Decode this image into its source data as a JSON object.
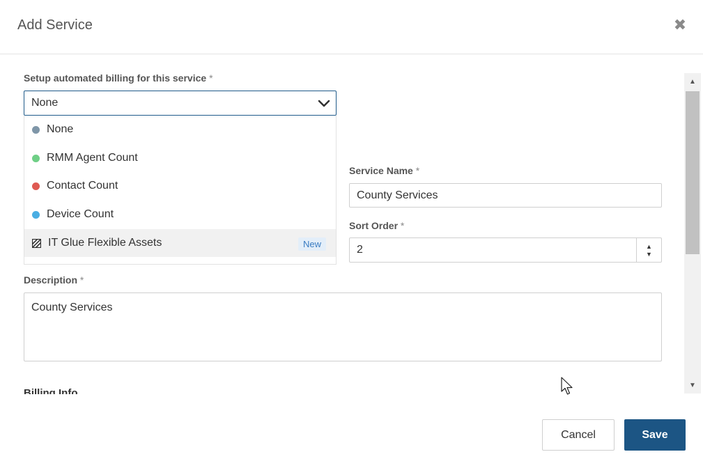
{
  "modal": {
    "title": "Add Service",
    "close_icon": "close-icon"
  },
  "billing": {
    "label": "Setup automated billing for this service",
    "required_mark": "*",
    "selected": "None",
    "options": [
      {
        "label": "None",
        "dot_color": "#7f96a8"
      },
      {
        "label": "RMM Agent Count",
        "dot_color": "#6fcf86"
      },
      {
        "label": "Contact Count",
        "dot_color": "#df5a52"
      },
      {
        "label": "Device Count",
        "dot_color": "#4aaee3"
      },
      {
        "label": "IT Glue Flexible Assets",
        "icon": "it-glue-icon",
        "badge": "New"
      }
    ]
  },
  "service_name": {
    "label": "Service Name",
    "required_mark": "*",
    "value": "County Services"
  },
  "sort_order": {
    "label": "Sort Order",
    "required_mark": "*",
    "value": "2"
  },
  "description": {
    "label": "Description",
    "required_mark": "*",
    "value": "County Services"
  },
  "billing_info": {
    "heading": "Billing Info"
  },
  "footer": {
    "cancel_label": "Cancel",
    "save_label": "Save"
  },
  "colors": {
    "primary": "#1c5584",
    "badge_bg": "#e3eef9",
    "badge_text": "#3a7cc2"
  }
}
